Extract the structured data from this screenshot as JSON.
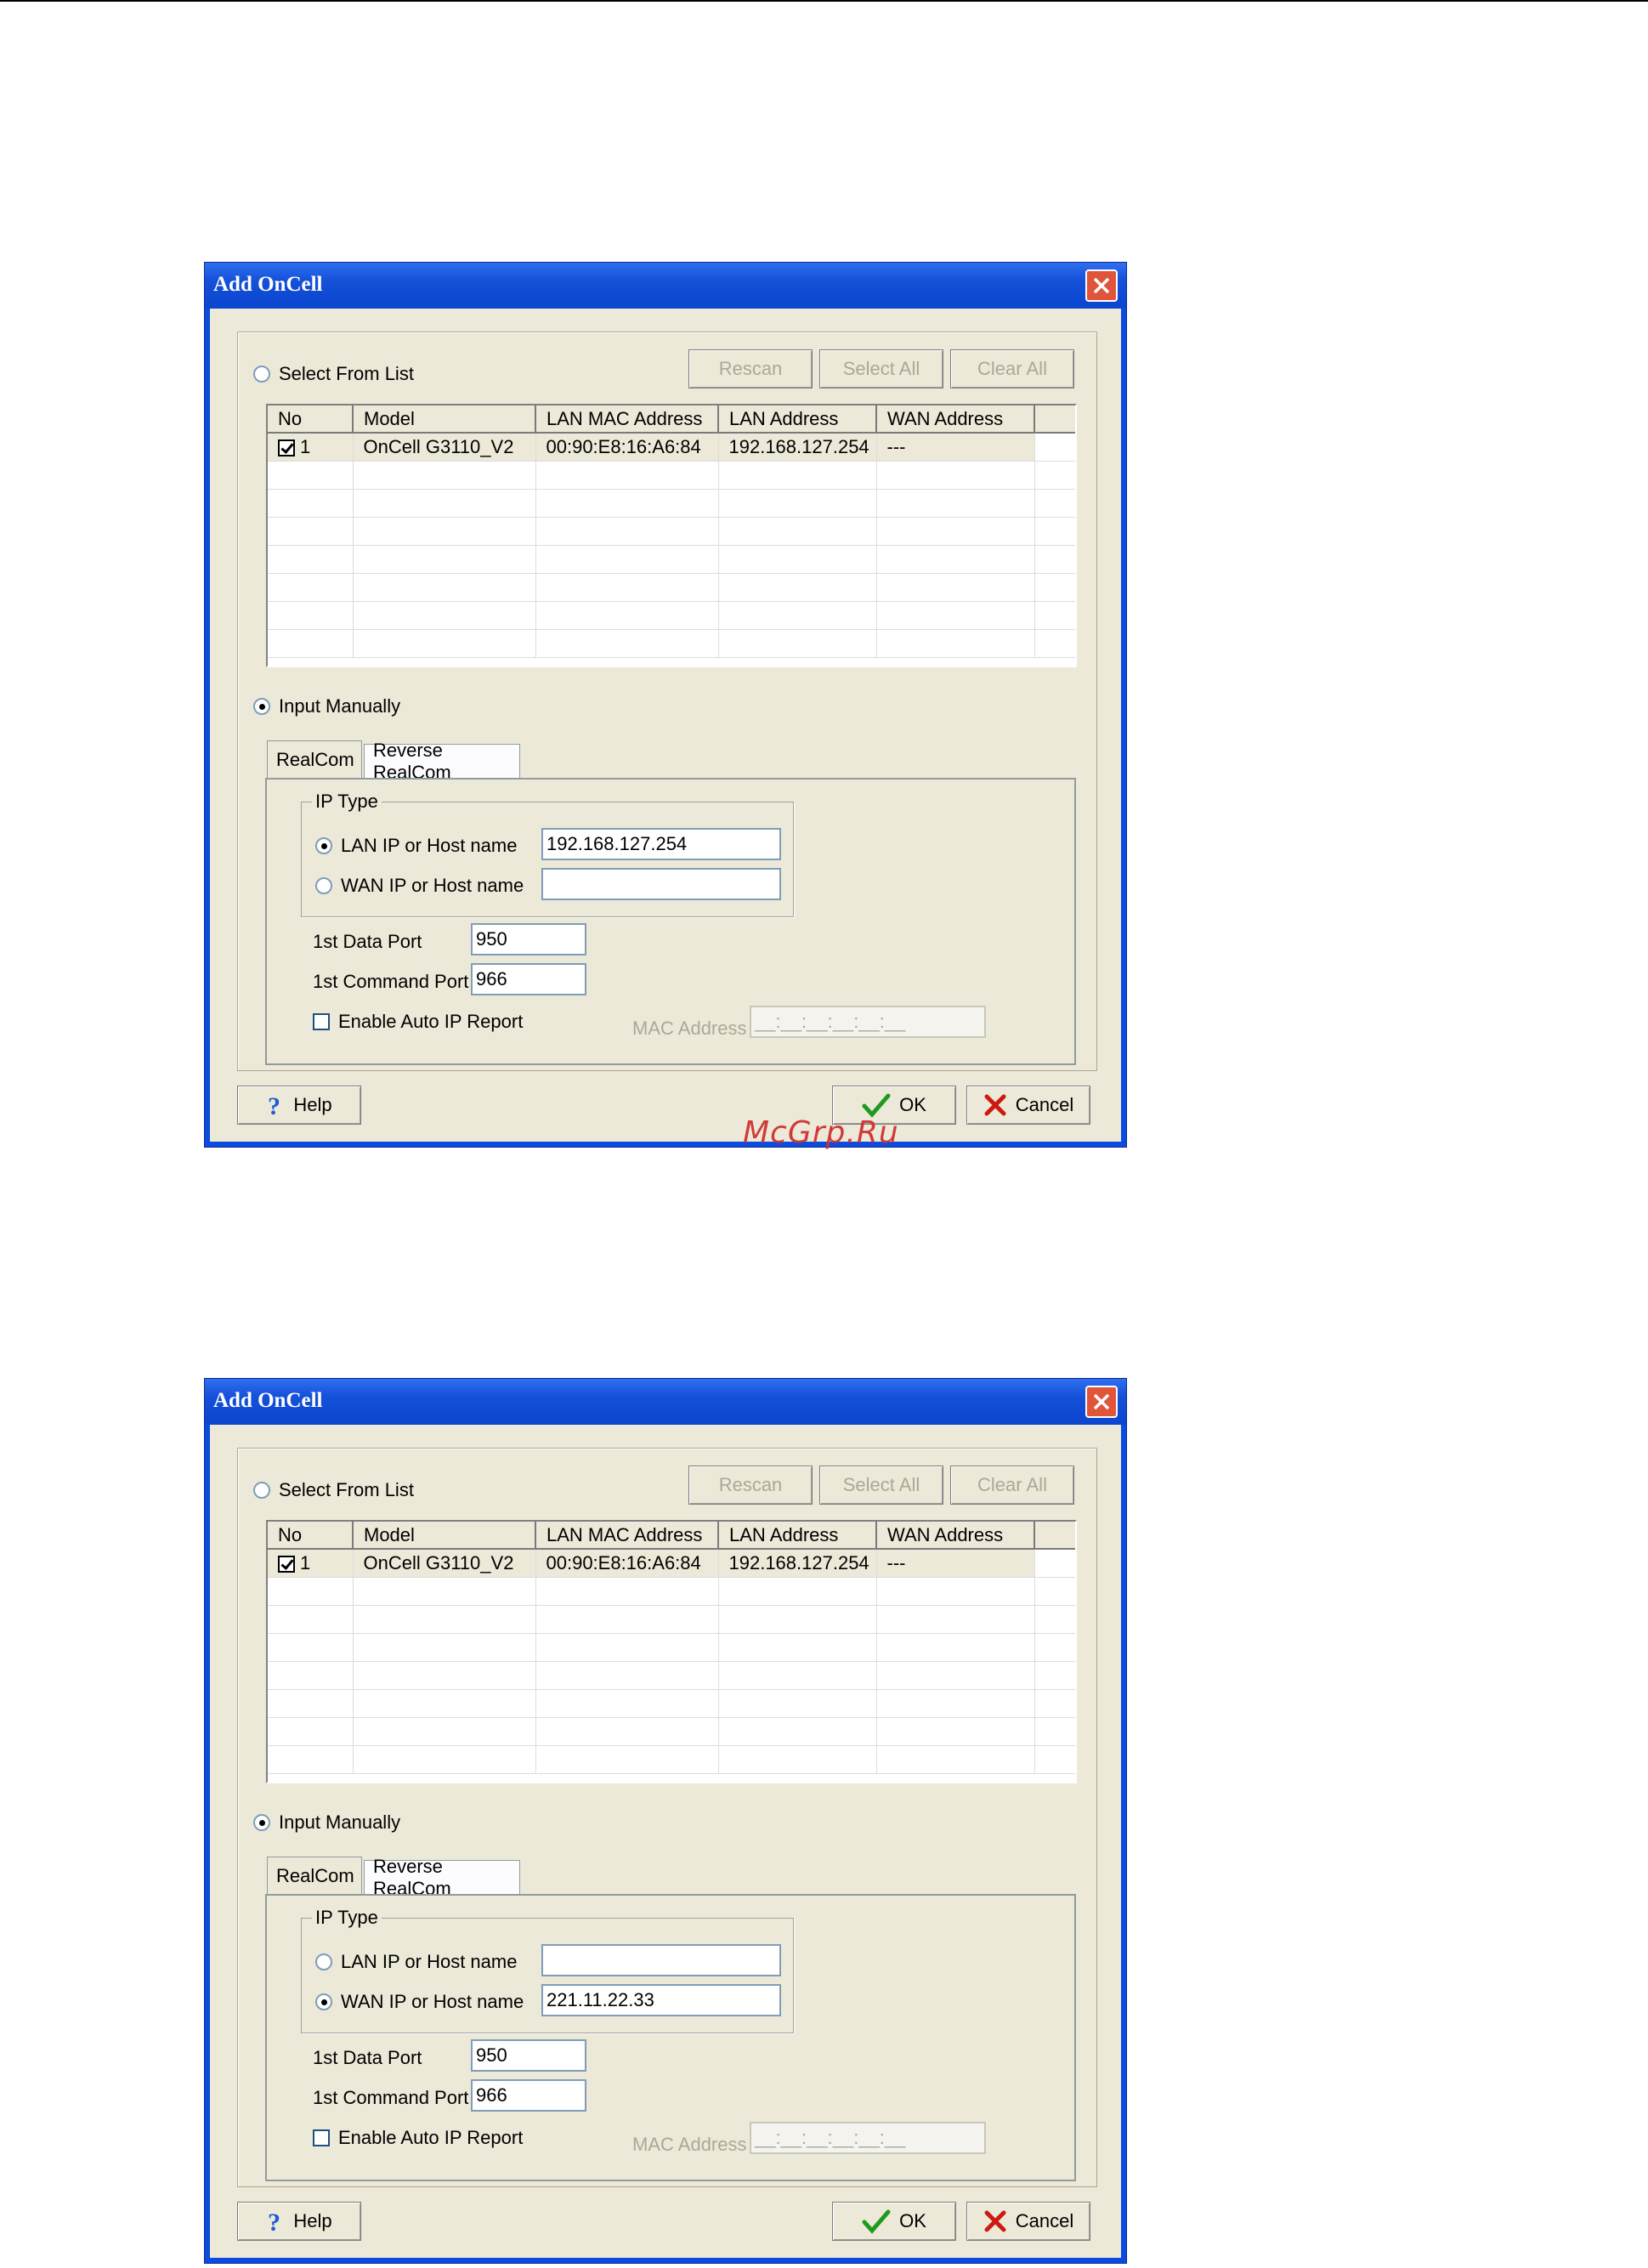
{
  "watermark": "McGrp.Ru",
  "dialogs": [
    {
      "title": "Add OnCell",
      "select_from_list": "Select From List",
      "buttons": {
        "rescan": "Rescan",
        "select_all": "Select All",
        "clear_all": "Clear All"
      },
      "table": {
        "headers": [
          "No",
          "Model",
          "LAN MAC Address",
          "LAN Address",
          "WAN Address"
        ],
        "rows": [
          [
            "1",
            "OnCell G3110_V2",
            "00:90:E8:16:A6:84",
            "192.168.127.254",
            "---"
          ]
        ]
      },
      "input_manually": "Input Manually",
      "tabs": [
        "RealCom",
        "Reverse RealCom"
      ],
      "ip_type": "IP Type",
      "lan_ip_label": "LAN IP or Host name",
      "lan_ip_value": "192.168.127.254",
      "wan_ip_label": "WAN IP or Host name",
      "wan_ip_value": "",
      "data_port_label": "1st Data Port",
      "data_port_value": "950",
      "command_port_label": "1st Command Port",
      "command_port_value": "966",
      "auto_ip_report": "Enable Auto IP Report",
      "mac_address_label": "MAC Address",
      "mac_address_mask": "__:__:__:__:__:__",
      "help": "Help",
      "ok": "OK",
      "cancel": "Cancel",
      "selected_ip_type": "LAN"
    },
    {
      "title": "Add OnCell",
      "select_from_list": "Select From List",
      "buttons": {
        "rescan": "Rescan",
        "select_all": "Select All",
        "clear_all": "Clear All"
      },
      "table": {
        "headers": [
          "No",
          "Model",
          "LAN MAC Address",
          "LAN Address",
          "WAN Address"
        ],
        "rows": [
          [
            "1",
            "OnCell G3110_V2",
            "00:90:E8:16:A6:84",
            "192.168.127.254",
            "---"
          ]
        ]
      },
      "input_manually": "Input Manually",
      "tabs": [
        "RealCom",
        "Reverse RealCom"
      ],
      "ip_type": "IP Type",
      "lan_ip_label": "LAN IP or Host name",
      "lan_ip_value": "",
      "wan_ip_label": "WAN IP or Host name",
      "wan_ip_value": "221.11.22.33",
      "data_port_label": "1st Data Port",
      "data_port_value": "950",
      "command_port_label": "1st Command Port",
      "command_port_value": "966",
      "auto_ip_report": "Enable Auto IP Report",
      "mac_address_label": "MAC Address",
      "mac_address_mask": "__:__:__:__:__:__",
      "help": "Help",
      "ok": "OK",
      "cancel": "Cancel",
      "selected_ip_type": "WAN"
    }
  ]
}
